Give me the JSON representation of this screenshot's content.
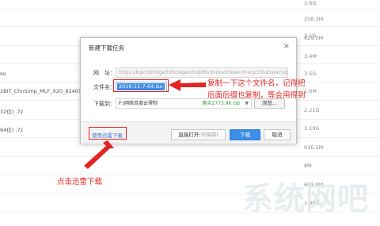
{
  "background": {
    "sizes": [
      "3.6G",
      "258.3M",
      "3.1G",
      "629.5M",
      "3.4M",
      "3.5G",
      "1.6M",
      "2.21G",
      "3.19G",
      "916.5M",
      "8M",
      "693.8M",
      "1.06G"
    ],
    "names": [
      "so",
      "2BIT_ChnSimp_MLF_X20_82401_10",
      "32位) .7z",
      "64位) .7z"
    ]
  },
  "dialog": {
    "title": "新建下载任务",
    "close": "×",
    "url_label": "网　址：",
    "url_value": "https://bge3dmttga33hctogezdnqbf61dnmuncfwse7mocp33ha5sjwcsqka",
    "filename_label": "文件名：",
    "filename_value": "2016-11-7-64.iso",
    "dest_label": "下载到：",
    "dest_path": "F:\\网络百度云得制",
    "dest_free": "剩余2773.96 GB",
    "dest_arrow": "▼",
    "browse": "浏览...",
    "xunlei_link": "使用迅雷下载",
    "open_direct": "直接打开",
    "open_direct_muted": "(不保存)",
    "download": "下载",
    "cancel": "取消"
  },
  "annotations": {
    "note_top_1": "复制一下这个文件名，记得把",
    "note_top_2": "后面后缀也复制，等会用得到",
    "note_bottom": "点击迅雷下载",
    "watermark": "系统网吧",
    "color": "#e12424"
  }
}
